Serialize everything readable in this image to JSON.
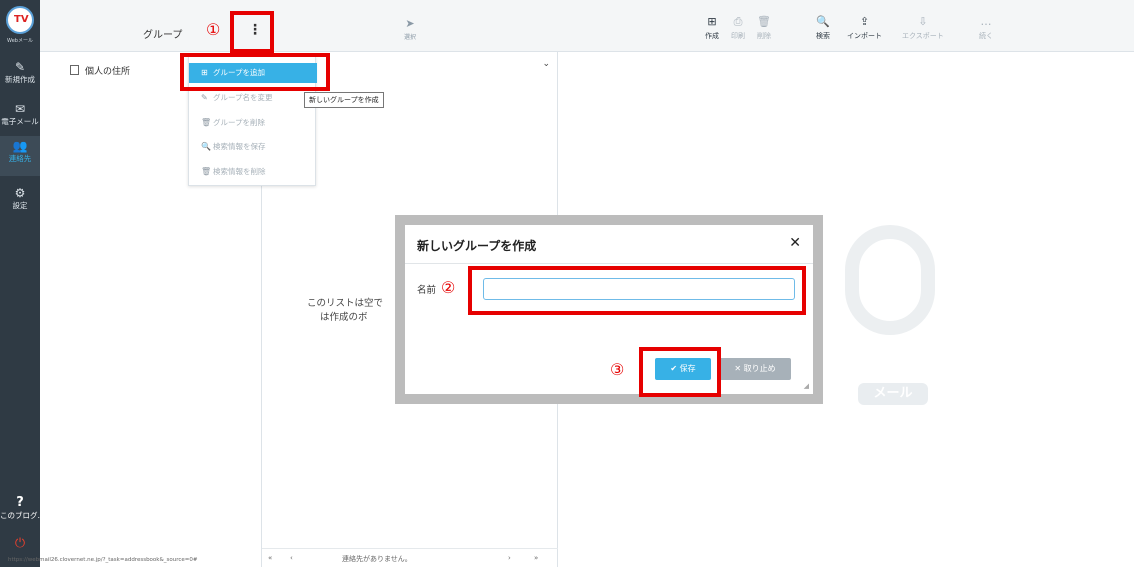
{
  "nav": {
    "logo_text": "TV",
    "logo_sub": "Webメール",
    "items": [
      {
        "icon": "compose-icon",
        "glyph": "✎",
        "label": "新規作成"
      },
      {
        "icon": "mail-icon",
        "glyph": "✉",
        "label": "電子メール"
      },
      {
        "icon": "contacts-icon",
        "glyph": "👥",
        "label": "連絡先"
      },
      {
        "icon": "gear-icon",
        "glyph": "⚙",
        "label": "設定"
      }
    ],
    "help": {
      "glyph": "?",
      "label": "このブログ…"
    },
    "logout_glyph": "⏻"
  },
  "groups": {
    "title": "グループ",
    "menu_glyph": "⋮",
    "address_book": "個人の住所",
    "status_url": "https://webmail26.clovernet.ne.jp/?_task=addressbook&_source=0#"
  },
  "group_menu": {
    "items": [
      {
        "label": "グループを追加",
        "glyph": "⊞"
      },
      {
        "label": "グループ名を変更",
        "glyph": "✎"
      },
      {
        "label": "グループを削除",
        "glyph": "🗑"
      },
      {
        "label": "検索情報を保存",
        "glyph": "🔍"
      },
      {
        "label": "検索情報を削除",
        "glyph": "🗑"
      }
    ],
    "tooltip": "新しいグループを作成"
  },
  "contacts": {
    "select_label": "選択",
    "select_glyph": "➤",
    "chevron": "⌄",
    "empty_line1": "このリストは空で",
    "empty_line2": "は作成のボ",
    "footer": {
      "first": "«",
      "prev": "‹",
      "status": "連絡先がありません。",
      "next": "›",
      "last": "»"
    }
  },
  "toolbar": {
    "items": [
      {
        "label": "作成",
        "glyph": "⊞",
        "enabled": true
      },
      {
        "label": "印刷",
        "glyph": "⎙",
        "enabled": false
      },
      {
        "label": "削除",
        "glyph": "🗑",
        "enabled": false
      },
      {
        "label": "検索",
        "glyph": "🔍",
        "enabled": true
      },
      {
        "label": "インポート",
        "glyph": "⇪",
        "enabled": true
      },
      {
        "label": "エクスポート",
        "glyph": "⇩",
        "enabled": false
      },
      {
        "label": "続く",
        "glyph": "…",
        "enabled": false
      }
    ],
    "watermark": "メール"
  },
  "dialog": {
    "title": "新しいグループを作成",
    "close": "✕",
    "name_label": "名前",
    "name_value": "",
    "save": "✔ 保存",
    "cancel": "✕ 取り止め"
  },
  "annotations": {
    "one": "①",
    "two": "②",
    "three": "③"
  },
  "colors": {
    "nav_bg": "#2f3a44",
    "accent": "#37b1e6",
    "annotation": "#e60000"
  }
}
